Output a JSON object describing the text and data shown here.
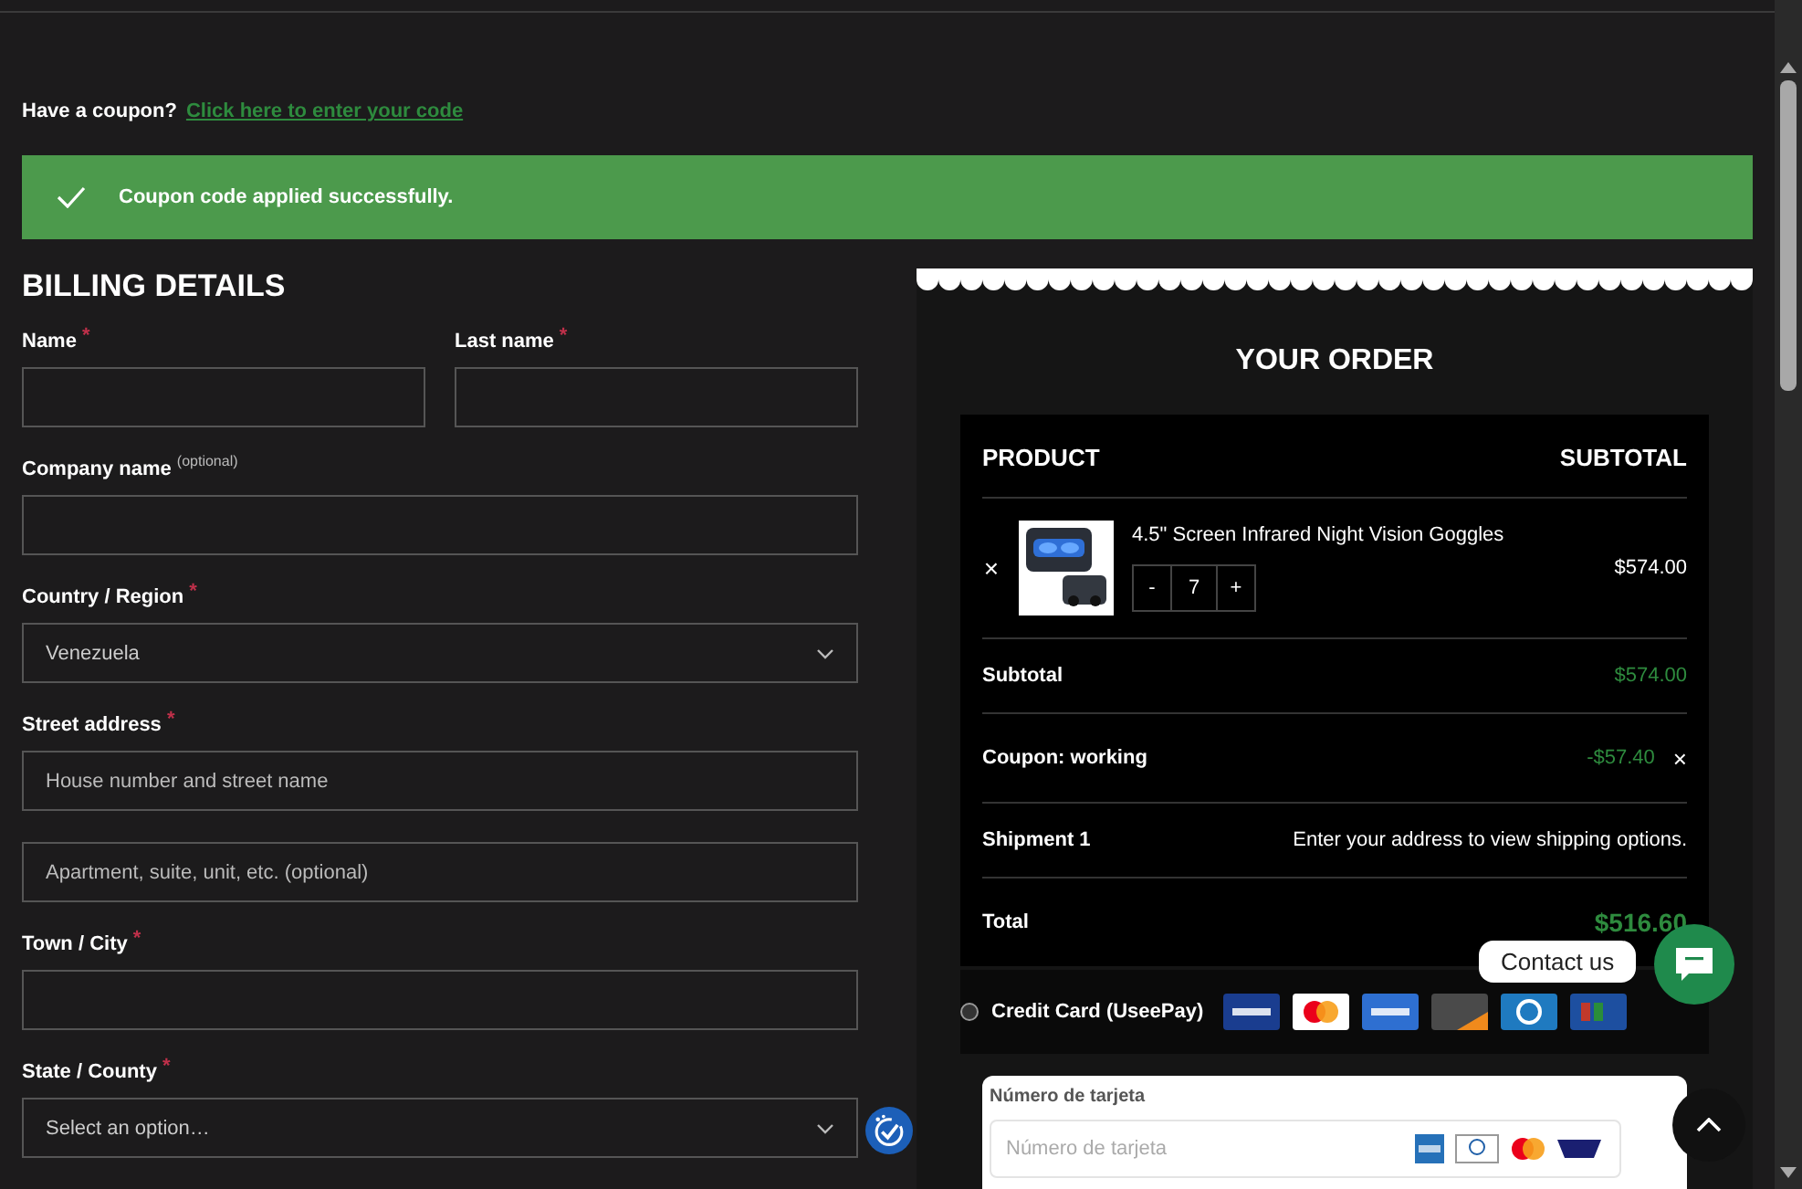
{
  "coupon_prompt": {
    "text": "Have a coupon?",
    "link": "Click here to enter your code"
  },
  "notice": {
    "message": "Coupon code applied successfully."
  },
  "billing": {
    "title": "BILLING DETAILS",
    "fields": [
      {
        "kind": "input",
        "label": "Name",
        "required_mark": "*",
        "half": true
      },
      {
        "kind": "input",
        "label": "Last name",
        "required_mark": "*",
        "half": true
      },
      {
        "kind": "input",
        "label": "Company name",
        "optional_note": "(optional)"
      },
      {
        "kind": "select",
        "label": "Country / Region",
        "required_mark": "*",
        "value": "Venezuela"
      },
      {
        "kind": "input",
        "label": "Street address",
        "required_mark": "*",
        "placeholder": "House number and street name"
      },
      {
        "kind": "input",
        "placeholder": "Apartment, suite, unit, etc. (optional)"
      },
      {
        "kind": "input",
        "label": "Town / City",
        "required_mark": "*"
      },
      {
        "kind": "select",
        "label": "State / County",
        "required_mark": "*",
        "value": "Select an option…"
      }
    ]
  },
  "order": {
    "title": "YOUR ORDER",
    "columns": [
      "PRODUCT",
      "SUBTOTAL"
    ],
    "items": [
      {
        "remove": "×",
        "name": "4.5\" Screen Infrared Night Vision Goggles",
        "minus": "-",
        "quantity": "7",
        "plus": "+",
        "price": "$574.00"
      }
    ],
    "totals": [
      {
        "kind": "amount",
        "label": "Subtotal",
        "value": "$574.00"
      },
      {
        "kind": "coupon",
        "label": "Coupon: working",
        "value": "-$57.40",
        "remove": "×"
      },
      {
        "kind": "note",
        "label": "Shipment 1",
        "value": "Enter your address to view shipping options."
      },
      {
        "kind": "total",
        "label": "Total",
        "value": "$516.60"
      }
    ]
  },
  "payment": {
    "method": "Credit Card (UseePay)",
    "selected": false,
    "card_label": "Número de tarjeta",
    "card_placeholder": "Número de tarjeta"
  },
  "chat": {
    "label": "Contact us"
  }
}
